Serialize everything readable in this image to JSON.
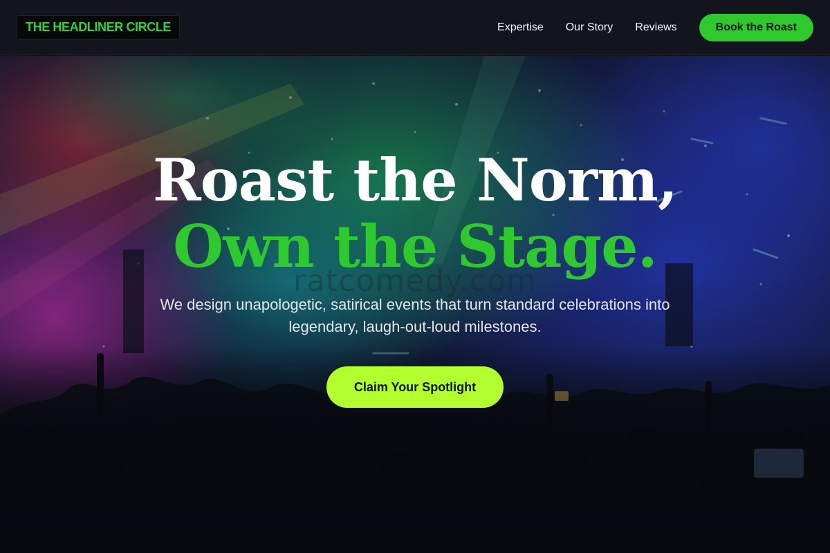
{
  "header": {
    "logo": "THE HEADLINER CIRCLE",
    "nav": [
      {
        "label": "Expertise"
      },
      {
        "label": "Our Story"
      },
      {
        "label": "Reviews"
      }
    ],
    "cta_label": "Book the Roast"
  },
  "hero": {
    "headline_line1": "Roast the Norm,",
    "headline_line2": "Own the Stage.",
    "subtext": "We design unapologetic, satirical events that turn standard celebrations into legendary, laugh-out-loud milestones.",
    "cta_label": "Claim Your Spotlight",
    "watermark": "ratcomedy.com"
  },
  "colors": {
    "accent_green": "#2ec92d",
    "cta_lime": "#b2ff2e",
    "header_bg": "#12151b"
  }
}
